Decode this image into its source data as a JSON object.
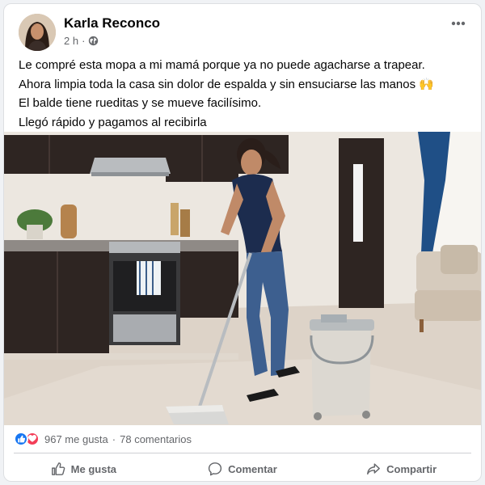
{
  "post": {
    "author": "Karla Reconco",
    "time": "2 h",
    "separator": "·",
    "privacy_icon": "globe-icon",
    "more_icon": "more-horizontal-icon",
    "lines": [
      "Le compré esta mopa a mi mamá porque ya no puede agacharse a trapear.",
      "Ahora limpia toda la casa sin dolor de espalda y sin ensuciarse las manos 🙌",
      "El balde tiene rueditas y se mueve facilísimo.",
      "Llegó rápido y pagamos al recibirla"
    ]
  },
  "reactions": {
    "icons": [
      "like-reaction-icon",
      "love-reaction-icon"
    ],
    "likes": "967 me gusta",
    "separator": "·",
    "comments": "78 comentarios"
  },
  "actions": {
    "like": "Me gusta",
    "comment": "Comentar",
    "share": "Compartir"
  },
  "colors": {
    "brand_blue": "#1877f2",
    "love_red": "#f33e58",
    "muted_text": "#65676b"
  }
}
